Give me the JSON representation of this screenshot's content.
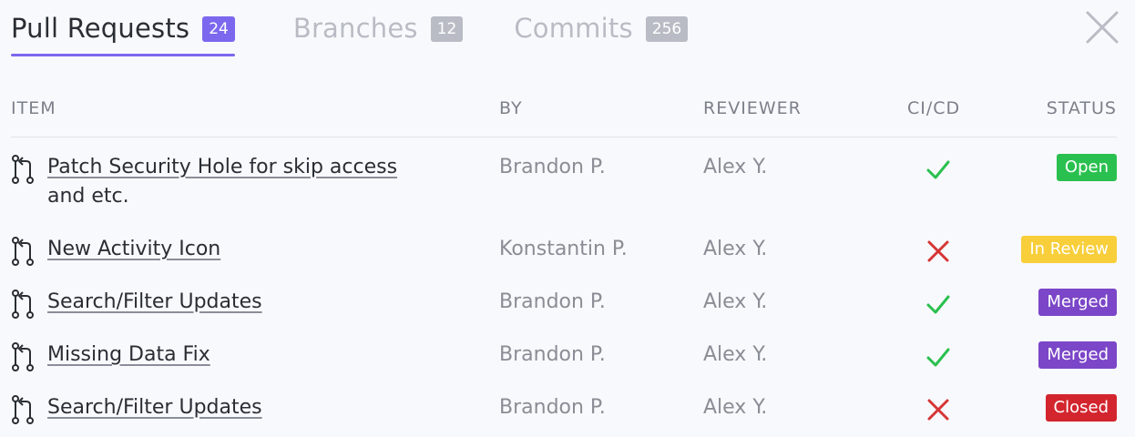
{
  "tabs": [
    {
      "label": "Pull Requests",
      "count": "24"
    },
    {
      "label": "Branches",
      "count": "12"
    },
    {
      "label": "Commits",
      "count": "256"
    }
  ],
  "columns": {
    "item": "ITEM",
    "by": "BY",
    "reviewer": "REVIEWER",
    "cicd": "CI/CD",
    "status": "STATUS"
  },
  "rows": [
    {
      "title_line1": "Patch Security Hole for skip access",
      "title_line2": "and etc.",
      "by": "Brandon P.",
      "reviewer": "Alex Y.",
      "ci": "pass",
      "status": "Open"
    },
    {
      "title_line1": "New Activity Icon",
      "title_line2": "",
      "by": "Konstantin P.",
      "reviewer": "Alex Y.",
      "ci": "fail",
      "status": "In Review"
    },
    {
      "title_line1": "Search/Filter Updates",
      "title_line2": "",
      "by": "Brandon P.",
      "reviewer": "Alex Y.",
      "ci": "pass",
      "status": "Merged"
    },
    {
      "title_line1": "Missing Data Fix",
      "title_line2": "",
      "by": "Brandon P.",
      "reviewer": "Alex Y.",
      "ci": "pass",
      "status": "Merged"
    },
    {
      "title_line1": "Search/Filter Updates",
      "title_line2": "",
      "by": "Brandon P.",
      "reviewer": "Alex Y.",
      "ci": "fail",
      "status": "Closed"
    }
  ],
  "colors": {
    "accent": "#7b68ee",
    "open": "#2ac04f",
    "in_review": "#f8ce3a",
    "merged": "#7b46c8",
    "closed": "#d3252e",
    "pass": "#2ac04f",
    "fail": "#d63535"
  },
  "icons": {
    "pr": "pull-request-icon",
    "pass": "check-icon",
    "fail": "x-icon",
    "close": "close-icon"
  }
}
